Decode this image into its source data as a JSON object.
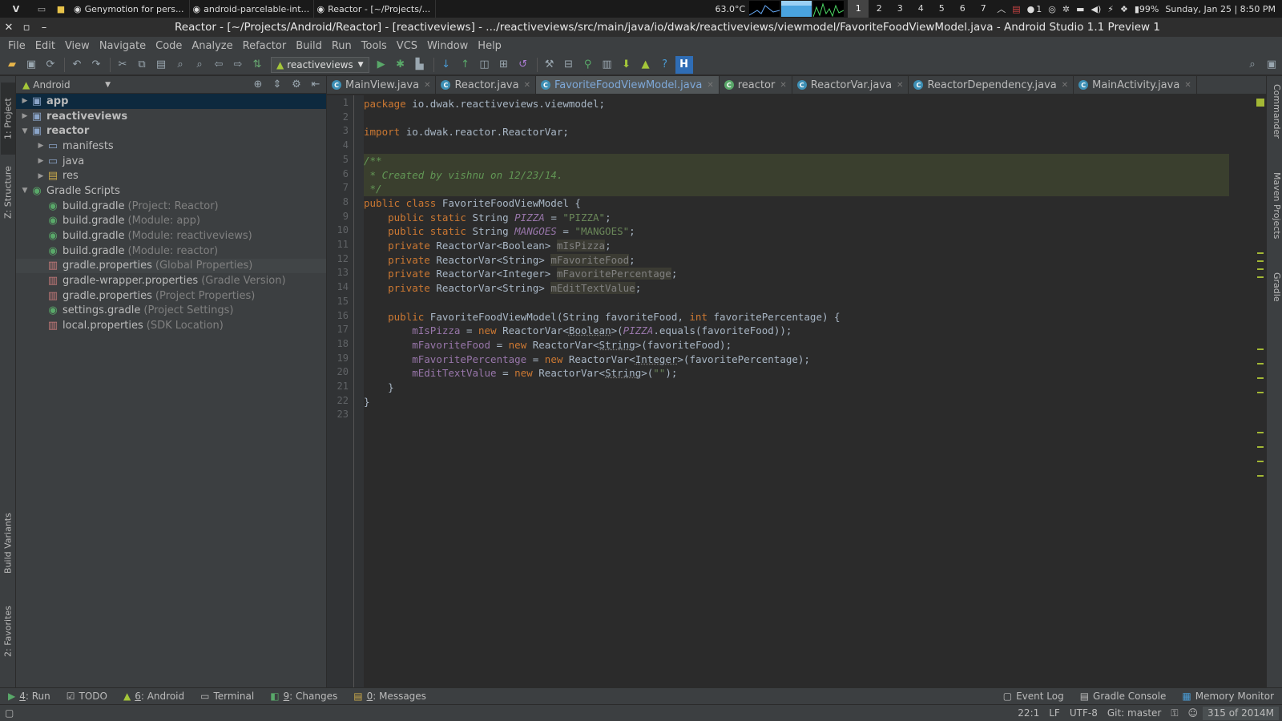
{
  "system_panel": {
    "menu_label": "V",
    "tasks": [
      {
        "label": "Genymotion for pers...",
        "icon": "genymotion-icon"
      },
      {
        "label": "android-parcelable-int...",
        "icon": "intellij-icon"
      },
      {
        "label": "Reactor - [~/Projects/...",
        "icon": "android-studio-icon"
      }
    ],
    "temperature": "63.0°C",
    "workspaces": [
      "1",
      "2",
      "3",
      "4",
      "5",
      "6",
      "7"
    ],
    "active_workspace": "1",
    "battery": "99%",
    "notify_count": "1",
    "clock": "Sunday, Jan 25 | 8:50 PM"
  },
  "window": {
    "title": "Reactor - [~/Projects/Android/Reactor] - [reactiveviews] - .../reactiveviews/src/main/java/io/dwak/reactiveviews/viewmodel/FavoriteFoodViewModel.java - Android Studio 1.1 Preview 1"
  },
  "menu": [
    "File",
    "Edit",
    "View",
    "Navigate",
    "Code",
    "Analyze",
    "Refactor",
    "Build",
    "Run",
    "Tools",
    "VCS",
    "Window",
    "Help"
  ],
  "toolbar": {
    "run_config": "reactiveviews"
  },
  "left_strip": {
    "project": "1: Project",
    "structure": "Z: Structure",
    "build_variants": "Build Variants",
    "favorites": "2: Favorites"
  },
  "right_strip": {
    "commander": "Commander",
    "maven": "Maven Projects",
    "gradle": "Gradle"
  },
  "project_panel": {
    "view_selector": "Android",
    "tree": [
      {
        "label": "app",
        "hint": "",
        "level": 0,
        "arrow": "right",
        "icon": "module-folder-icon",
        "bold": true,
        "state": "selected"
      },
      {
        "label": "reactiveviews",
        "hint": "",
        "level": 0,
        "arrow": "right",
        "icon": "module-folder-icon",
        "bold": true,
        "state": ""
      },
      {
        "label": "reactor",
        "hint": "",
        "level": 0,
        "arrow": "down",
        "icon": "module-folder-icon",
        "bold": true,
        "state": ""
      },
      {
        "label": "manifests",
        "hint": "",
        "level": 1,
        "arrow": "right",
        "icon": "folder-icon",
        "bold": false,
        "state": ""
      },
      {
        "label": "java",
        "hint": "",
        "level": 1,
        "arrow": "right",
        "icon": "folder-icon",
        "bold": false,
        "state": ""
      },
      {
        "label": "res",
        "hint": "",
        "level": 1,
        "arrow": "right",
        "icon": "res-folder-icon",
        "bold": false,
        "state": ""
      },
      {
        "label": "Gradle Scripts",
        "hint": "",
        "level": 0,
        "arrow": "down",
        "icon": "gradle-icon",
        "bold": false,
        "state": ""
      },
      {
        "label": "build.gradle",
        "hint": "(Project: Reactor)",
        "level": 1,
        "arrow": "",
        "icon": "gradle-icon",
        "bold": false,
        "state": ""
      },
      {
        "label": "build.gradle",
        "hint": "(Module: app)",
        "level": 1,
        "arrow": "",
        "icon": "gradle-icon",
        "bold": false,
        "state": ""
      },
      {
        "label": "build.gradle",
        "hint": "(Module: reactiveviews)",
        "level": 1,
        "arrow": "",
        "icon": "gradle-icon",
        "bold": false,
        "state": ""
      },
      {
        "label": "build.gradle",
        "hint": "(Module: reactor)",
        "level": 1,
        "arrow": "",
        "icon": "gradle-icon",
        "bold": false,
        "state": ""
      },
      {
        "label": "gradle.properties",
        "hint": "(Global Properties)",
        "level": 1,
        "arrow": "",
        "icon": "properties-icon",
        "bold": false,
        "state": "hl"
      },
      {
        "label": "gradle-wrapper.properties",
        "hint": "(Gradle Version)",
        "level": 1,
        "arrow": "",
        "icon": "properties-icon",
        "bold": false,
        "state": ""
      },
      {
        "label": "gradle.properties",
        "hint": "(Project Properties)",
        "level": 1,
        "arrow": "",
        "icon": "properties-icon",
        "bold": false,
        "state": ""
      },
      {
        "label": "settings.gradle",
        "hint": "(Project Settings)",
        "level": 1,
        "arrow": "",
        "icon": "gradle-icon",
        "bold": false,
        "state": ""
      },
      {
        "label": "local.properties",
        "hint": "(SDK Location)",
        "level": 1,
        "arrow": "",
        "icon": "properties-icon",
        "bold": false,
        "state": ""
      }
    ]
  },
  "editor_tabs": [
    {
      "label": "MainView.java",
      "active": false,
      "icon": "class-icon"
    },
    {
      "label": "Reactor.java",
      "active": false,
      "icon": "class-icon"
    },
    {
      "label": "FavoriteFoodViewModel.java",
      "active": true,
      "icon": "class-icon"
    },
    {
      "label": "reactor",
      "active": false,
      "icon": "gradle-icon"
    },
    {
      "label": "ReactorVar.java",
      "active": false,
      "icon": "class-icon"
    },
    {
      "label": "ReactorDependency.java",
      "active": false,
      "icon": "class-icon"
    },
    {
      "label": "MainActivity.java",
      "active": false,
      "icon": "class-icon"
    }
  ],
  "code_lines": [
    [
      [
        "kw",
        "package "
      ],
      [
        "",
        "io.dwak.reactiveviews.viewmodel;"
      ]
    ],
    [],
    [
      [
        "kw",
        "import "
      ],
      [
        "",
        "io.dwak.reactor.ReactorVar;"
      ]
    ],
    [],
    [
      [
        "cm",
        "/**"
      ]
    ],
    [
      [
        "cm",
        " * Created by vishnu on 12/23/14."
      ]
    ],
    [
      [
        "cm",
        " */"
      ]
    ],
    [
      [
        "kw",
        "public class "
      ],
      [
        "",
        "FavoriteFoodViewModel {"
      ]
    ],
    [
      [
        "",
        "    "
      ],
      [
        "kw",
        "public static "
      ],
      [
        "",
        "String "
      ],
      [
        "sf",
        "PIZZA"
      ],
      [
        "",
        " = "
      ],
      [
        "str",
        "\"PIZZA\""
      ],
      [
        "",
        ";"
      ]
    ],
    [
      [
        "",
        "    "
      ],
      [
        "kw",
        "public static "
      ],
      [
        "",
        "String "
      ],
      [
        "sf",
        "MANGOES"
      ],
      [
        "",
        " = "
      ],
      [
        "str",
        "\"MANGOES\""
      ],
      [
        "",
        ";"
      ]
    ],
    [
      [
        "",
        "    "
      ],
      [
        "kw",
        "private "
      ],
      [
        "",
        "ReactorVar<Boolean> "
      ],
      [
        "unused",
        "mIsPizza"
      ],
      [
        "",
        ";"
      ]
    ],
    [
      [
        "",
        "    "
      ],
      [
        "kw",
        "private "
      ],
      [
        "",
        "ReactorVar<String> "
      ],
      [
        "unused",
        "mFavoriteFood"
      ],
      [
        "",
        ";"
      ]
    ],
    [
      [
        "",
        "    "
      ],
      [
        "kw",
        "private "
      ],
      [
        "",
        "ReactorVar<Integer> "
      ],
      [
        "unused",
        "mFavoritePercentage"
      ],
      [
        "",
        ";"
      ]
    ],
    [
      [
        "",
        "    "
      ],
      [
        "kw",
        "private "
      ],
      [
        "",
        "ReactorVar<String> "
      ],
      [
        "unused",
        "mEditTextValue"
      ],
      [
        "",
        ";"
      ]
    ],
    [],
    [
      [
        "",
        "    "
      ],
      [
        "kw",
        "public "
      ],
      [
        "",
        "FavoriteFoodViewModel(String favoriteFood, "
      ],
      [
        "kw",
        "int "
      ],
      [
        "",
        "favoritePercentage) {"
      ]
    ],
    [
      [
        "",
        "        "
      ],
      [
        "fld",
        "mIsPizza"
      ],
      [
        "",
        " = "
      ],
      [
        "kw",
        "new "
      ],
      [
        "",
        "ReactorVar<"
      ],
      [
        "wav",
        "Boolean"
      ],
      [
        "",
        ">("
      ],
      [
        "sf",
        "PIZZA"
      ],
      [
        "",
        ".equals(favoriteFood));"
      ]
    ],
    [
      [
        "",
        "        "
      ],
      [
        "fld",
        "mFavoriteFood"
      ],
      [
        "",
        " = "
      ],
      [
        "kw",
        "new "
      ],
      [
        "",
        "ReactorVar<"
      ],
      [
        "wav",
        "String"
      ],
      [
        "",
        ">(favoriteFood);"
      ]
    ],
    [
      [
        "",
        "        "
      ],
      [
        "fld",
        "mFavoritePercentage"
      ],
      [
        "",
        " = "
      ],
      [
        "kw",
        "new "
      ],
      [
        "",
        "ReactorVar<"
      ],
      [
        "wav",
        "Integer"
      ],
      [
        "",
        ">(favoritePercentage);"
      ]
    ],
    [
      [
        "",
        "        "
      ],
      [
        "fld",
        "mEditTextValue"
      ],
      [
        "",
        " = "
      ],
      [
        "kw",
        "new "
      ],
      [
        "",
        "ReactorVar<"
      ],
      [
        "wav",
        "String"
      ],
      [
        "",
        ">("
      ],
      [
        "str",
        "\"\""
      ],
      [
        "",
        ");"
      ]
    ],
    [
      [
        "",
        "    }"
      ]
    ],
    [
      [
        "",
        "}"
      ]
    ],
    []
  ],
  "bottom_tools": [
    {
      "num": "4",
      "label": ": Run",
      "icon": "run-icon"
    },
    {
      "num": "",
      "label": "TODO",
      "icon": "todo-icon"
    },
    {
      "num": "6",
      "label": ": Android",
      "icon": "android-icon"
    },
    {
      "num": "",
      "label": "Terminal",
      "icon": "terminal-icon"
    },
    {
      "num": "9",
      "label": ": Changes",
      "icon": "changes-icon"
    },
    {
      "num": "0",
      "label": ": Messages",
      "icon": "messages-icon"
    }
  ],
  "bottom_right_tools": [
    {
      "label": "Event Log",
      "icon": "event-log-icon"
    },
    {
      "label": "Gradle Console",
      "icon": "gradle-console-icon"
    },
    {
      "label": "Memory Monitor",
      "icon": "memory-monitor-icon"
    }
  ],
  "status": {
    "position": "22:1",
    "line_sep": "LF",
    "encoding": "UTF-8",
    "vcs": "Git: master",
    "memory": "315 of 2014M"
  },
  "colors": {
    "keyword": "#cc7832",
    "string": "#6a8759",
    "field": "#9876aa",
    "comment": "#629755",
    "selection": "#0d293e"
  }
}
